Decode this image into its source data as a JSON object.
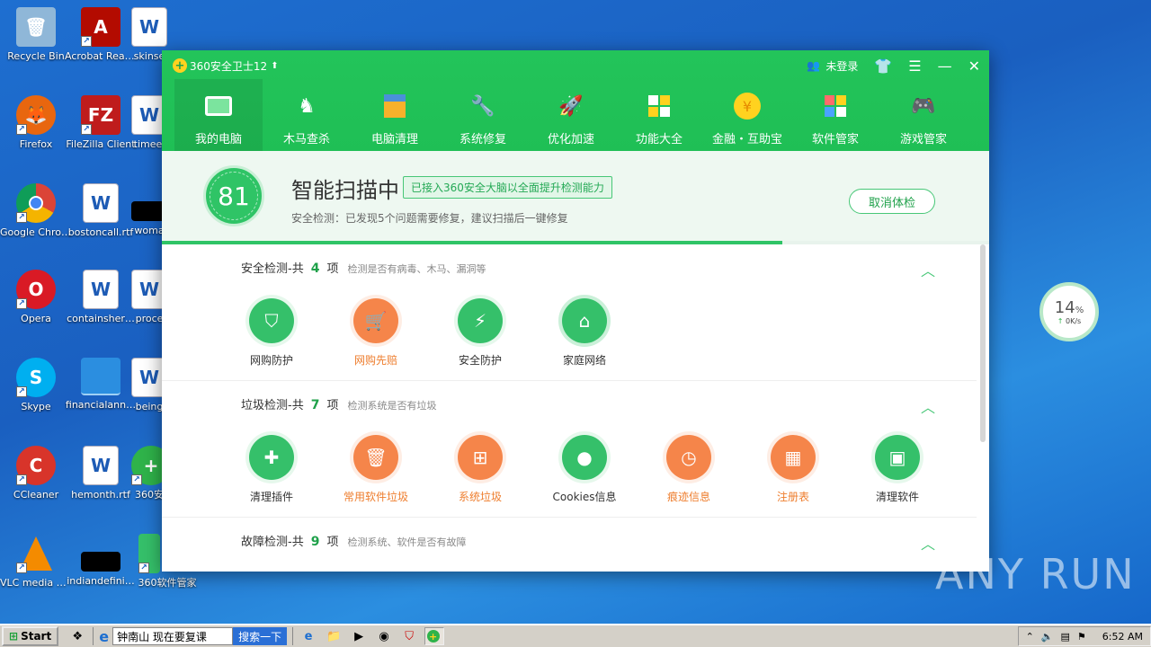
{
  "desktop": {
    "icons": [
      {
        "label": "Recycle Bin",
        "icon": "recycle-bin-icon"
      },
      {
        "label": "Acrobat Reader DC",
        "icon": "acrobat-icon"
      },
      {
        "label": "skinse",
        "icon": "word-doc-icon"
      },
      {
        "label": "Firefox",
        "icon": "firefox-icon"
      },
      {
        "label": "FileZilla Client",
        "icon": "filezilla-icon"
      },
      {
        "label": "timeel",
        "icon": "word-doc-icon"
      },
      {
        "label": "Google Chrome",
        "icon": "chrome-icon"
      },
      {
        "label": "bostoncall.rtf",
        "icon": "word-doc-icon"
      },
      {
        "label": "woma",
        "icon": "black-file-icon"
      },
      {
        "label": "Opera",
        "icon": "opera-icon"
      },
      {
        "label": "containsher…",
        "icon": "word-doc-icon"
      },
      {
        "label": "proce",
        "icon": "word-doc-icon"
      },
      {
        "label": "Skype",
        "icon": "skype-icon"
      },
      {
        "label": "financialann…",
        "icon": "blank-file-icon"
      },
      {
        "label": "being",
        "icon": "word-doc-icon"
      },
      {
        "label": "CCleaner",
        "icon": "ccleaner-icon"
      },
      {
        "label": "hemonth.rtf",
        "icon": "word-doc-icon"
      },
      {
        "label": "360安",
        "icon": "360-icon"
      },
      {
        "label": "VLC media player",
        "icon": "vlc-icon"
      },
      {
        "label": "indiandefini…",
        "icon": "black-file-icon"
      },
      {
        "label": "360软件管家",
        "icon": "360-softmgr-icon"
      }
    ]
  },
  "window": {
    "app_title": "360安全卫士12",
    "login_label": "未登录",
    "nav": [
      {
        "label": "我的电脑",
        "icon": "computer-icon",
        "active": true
      },
      {
        "label": "木马查杀",
        "icon": "horse-icon"
      },
      {
        "label": "电脑清理",
        "icon": "broom-icon"
      },
      {
        "label": "系统修复",
        "icon": "wrench-icon"
      },
      {
        "label": "优化加速",
        "icon": "rocket-icon"
      },
      {
        "label": "功能大全",
        "icon": "grid-icon"
      },
      {
        "label": "金融・互助宝",
        "icon": "yen-coin-icon"
      },
      {
        "label": "软件管家",
        "icon": "apps-icon"
      },
      {
        "label": "游戏管家",
        "icon": "gamepad-icon"
      }
    ]
  },
  "scan": {
    "score": "81",
    "title": "智能扫描中",
    "tag": "已接入360安全大脑以全面提升检测能力",
    "subtitle": "安全检测：已发现5个问题需要修复，建议扫描后一键修复",
    "cancel_label": "取消体检",
    "progress": 0.75
  },
  "sections": [
    {
      "title": "安全检测-共",
      "count": "4",
      "unit": "项",
      "desc": "检测是否有病毒、木马、漏洞等",
      "items": [
        {
          "label": "网购防护",
          "icon": "shield-icon",
          "warn": false
        },
        {
          "label": "网购先赔",
          "icon": "cart-icon",
          "warn": true
        },
        {
          "label": "安全防护",
          "icon": "shield-bolt-icon",
          "warn": false
        },
        {
          "label": "家庭网络",
          "icon": "home-wifi-icon",
          "warn": false
        }
      ]
    },
    {
      "title": "垃圾检测-共",
      "count": "7",
      "unit": "项",
      "desc": "检测系统是否有垃圾",
      "items": [
        {
          "label": "清理插件",
          "icon": "puzzle-icon",
          "warn": false
        },
        {
          "label": "常用软件垃圾",
          "icon": "trash-icon",
          "warn": true
        },
        {
          "label": "系统垃圾",
          "icon": "windows-icon",
          "warn": true
        },
        {
          "label": "Cookies信息",
          "icon": "cookie-icon",
          "warn": false
        },
        {
          "label": "痕迹信息",
          "icon": "clock-icon",
          "warn": true
        },
        {
          "label": "注册表",
          "icon": "registry-icon",
          "warn": true
        },
        {
          "label": "清理软件",
          "icon": "gift-box-icon",
          "warn": false
        }
      ]
    },
    {
      "title": "故障检测-共",
      "count": "9",
      "unit": "项",
      "desc": "检测系统、软件是否有故障",
      "items": []
    }
  ],
  "speed_widget": {
    "percent": "14",
    "unit": "%",
    "rate": "0K/s"
  },
  "watermark": "ANY RUN",
  "taskbar": {
    "start_label": "Start",
    "search_query": "钟南山 现在要复课",
    "search_button": "搜索一下",
    "clock": "6:52 AM"
  },
  "colors": {
    "brand_green": "#1fbf55",
    "warn_orange": "#f5854a",
    "desktop_blue": "#1e6fd0"
  }
}
